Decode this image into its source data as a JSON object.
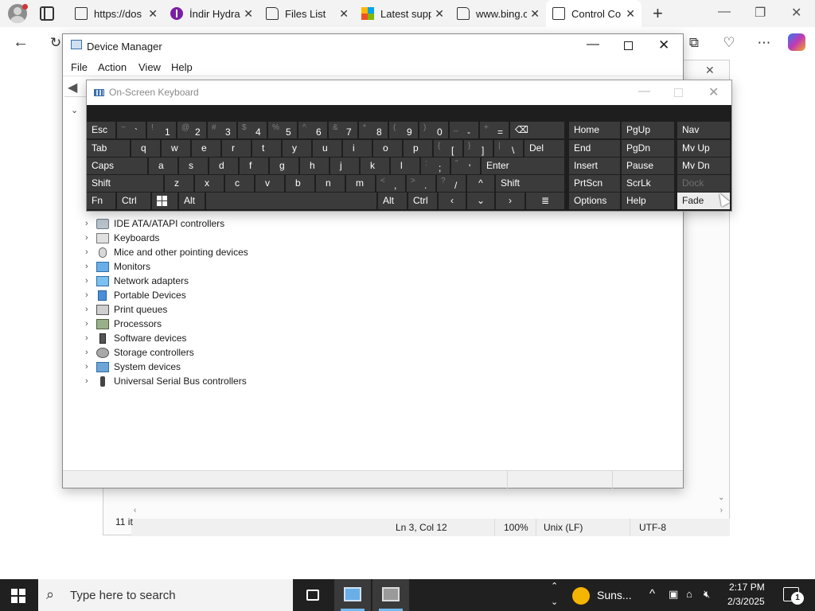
{
  "browser": {
    "tabs": [
      {
        "title": "https://dos",
        "icon": "document-icon",
        "active": false
      },
      {
        "title": "İndir Hydra",
        "icon": "app-icon",
        "active": false
      },
      {
        "title": "Files List",
        "icon": "file-icon",
        "active": false
      },
      {
        "title": "Latest supp",
        "icon": "microsoft-icon",
        "active": false
      },
      {
        "title": "www.bing.c",
        "icon": "bing-file-icon",
        "active": false
      },
      {
        "title": "Control Co",
        "icon": "document-icon",
        "active": true
      }
    ],
    "new_tab_symbol": "+"
  },
  "notepad": {
    "status": {
      "position": "Ln 3, Col 12",
      "zoom": "100%",
      "line_ending": "Unix (LF)",
      "encoding": "UTF-8"
    },
    "item_count": "11 it"
  },
  "device_manager": {
    "title": "Device Manager",
    "menu": [
      "File",
      "Action",
      "View",
      "Help"
    ],
    "tree_items": [
      {
        "label": "IDE ATA/ATAPI controllers",
        "icon": "disk-controller-icon"
      },
      {
        "label": "Keyboards",
        "icon": "keyboard-icon"
      },
      {
        "label": "Mice and other pointing devices",
        "icon": "mouse-icon"
      },
      {
        "label": "Monitors",
        "icon": "monitor-icon"
      },
      {
        "label": "Network adapters",
        "icon": "network-icon"
      },
      {
        "label": "Portable Devices",
        "icon": "portable-device-icon"
      },
      {
        "label": "Print queues",
        "icon": "printer-icon"
      },
      {
        "label": "Processors",
        "icon": "processor-icon"
      },
      {
        "label": "Software devices",
        "icon": "software-device-icon"
      },
      {
        "label": "Storage controllers",
        "icon": "storage-icon"
      },
      {
        "label": "System devices",
        "icon": "system-device-icon"
      },
      {
        "label": "Universal Serial Bus controllers",
        "icon": "usb-icon"
      }
    ]
  },
  "osk": {
    "title": "On-Screen Keyboard",
    "row1": {
      "esc": "Esc",
      "keys": [
        {
          "shift": "~",
          "main": "`"
        },
        {
          "shift": "!",
          "main": "1"
        },
        {
          "shift": "@",
          "main": "2"
        },
        {
          "shift": "#",
          "main": "3"
        },
        {
          "shift": "$",
          "main": "4"
        },
        {
          "shift": "%",
          "main": "5"
        },
        {
          "shift": "^",
          "main": "6"
        },
        {
          "shift": "&",
          "main": "7"
        },
        {
          "shift": "*",
          "main": "8"
        },
        {
          "shift": "(",
          "main": "9"
        },
        {
          "shift": ")",
          "main": "0"
        },
        {
          "shift": "_",
          "main": "-"
        },
        {
          "shift": "+",
          "main": "="
        }
      ],
      "backspace": "⌫"
    },
    "row2": {
      "tab": "Tab",
      "letters": [
        "q",
        "w",
        "e",
        "r",
        "t",
        "y",
        "u",
        "i",
        "o",
        "p"
      ],
      "brackets": [
        {
          "shift": "{",
          "main": "["
        },
        {
          "shift": "}",
          "main": "]"
        },
        {
          "shift": "|",
          "main": "\\"
        }
      ],
      "del": "Del"
    },
    "row3": {
      "caps": "Caps",
      "letters": [
        "a",
        "s",
        "d",
        "f",
        "g",
        "h",
        "j",
        "k",
        "l"
      ],
      "punct": [
        {
          "shift": ":",
          "main": ";"
        },
        {
          "shift": "\"",
          "main": "'"
        }
      ],
      "enter": "Enter"
    },
    "row4": {
      "shift_left": "Shift",
      "letters": [
        "z",
        "x",
        "c",
        "v",
        "b",
        "n",
        "m"
      ],
      "punct": [
        {
          "shift": "<",
          "main": ","
        },
        {
          "shift": ">",
          "main": "."
        },
        {
          "shift": "?",
          "main": "/"
        }
      ],
      "up": "^",
      "shift_right": "Shift"
    },
    "row5": {
      "fn": "Fn",
      "ctrl_left": "Ctrl",
      "alt_left": "Alt",
      "alt_right": "Alt",
      "ctrl_right": "Ctrl",
      "left": "‹",
      "down": "⌄",
      "right": "›",
      "menu": "≣"
    },
    "nav": {
      "col1": [
        "Home",
        "End",
        "Insert",
        "PrtScn",
        "Options"
      ],
      "col2": [
        "PgUp",
        "PgDn",
        "Pause",
        "ScrLk",
        "Help"
      ],
      "col3": [
        "Nav",
        "Mv Up",
        "Mv Dn",
        "Dock",
        "Fade"
      ]
    }
  },
  "taskbar": {
    "search_placeholder": "Type here to search",
    "weather": "Suns...",
    "time": "2:17 PM",
    "date": "2/3/2025",
    "notifications": "1"
  }
}
